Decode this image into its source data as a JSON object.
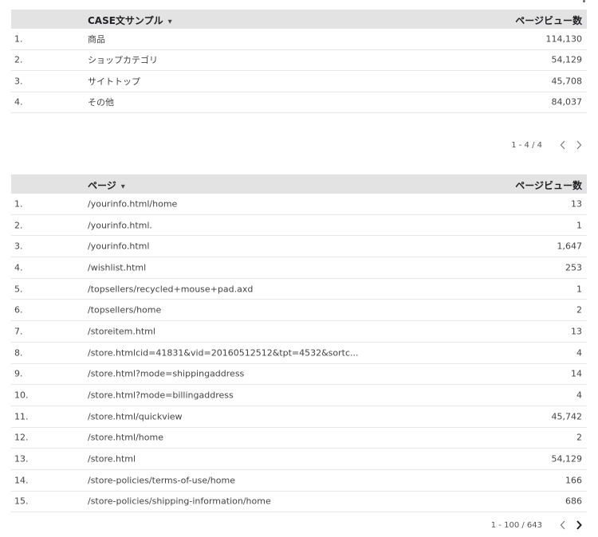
{
  "table1": {
    "header": {
      "dimension": "CASE文サンプル",
      "metric": "ページビュー数"
    },
    "rows": [
      {
        "index": "1.",
        "label": "商品",
        "value": "114,130"
      },
      {
        "index": "2.",
        "label": "ショップカテゴリ",
        "value": "54,129"
      },
      {
        "index": "3.",
        "label": "サイトトップ",
        "value": "45,708"
      },
      {
        "index": "4.",
        "label": "その他",
        "value": "84,037"
      }
    ],
    "pager": {
      "range": "1 - 4 / 4"
    }
  },
  "table2": {
    "header": {
      "dimension": "ページ",
      "metric": "ページビュー数"
    },
    "rows": [
      {
        "index": "1.",
        "label": "/yourinfo.html/home",
        "value": "13"
      },
      {
        "index": "2.",
        "label": "/yourinfo.html.",
        "value": "1"
      },
      {
        "index": "3.",
        "label": "/yourinfo.html",
        "value": "1,647"
      },
      {
        "index": "4.",
        "label": "/wishlist.html",
        "value": "253"
      },
      {
        "index": "5.",
        "label": "/topsellers/recycled+mouse+pad.axd",
        "value": "1"
      },
      {
        "index": "6.",
        "label": "/topsellers/home",
        "value": "2"
      },
      {
        "index": "7.",
        "label": "/storeitem.html",
        "value": "13"
      },
      {
        "index": "8.",
        "label": "/store.htmlcid=41831&vid=20160512512&tpt=4532&sortc...",
        "value": "4"
      },
      {
        "index": "9.",
        "label": "/store.html?mode=shippingaddress",
        "value": "14"
      },
      {
        "index": "10.",
        "label": "/store.html?mode=billingaddress",
        "value": "4"
      },
      {
        "index": "11.",
        "label": "/store.html/quickview",
        "value": "45,742"
      },
      {
        "index": "12.",
        "label": "/store.html/home",
        "value": "2"
      },
      {
        "index": "13.",
        "label": "/store.html",
        "value": "54,129"
      },
      {
        "index": "14.",
        "label": "/store-policies/terms-of-use/home",
        "value": "166"
      },
      {
        "index": "15.",
        "label": "/store-policies/shipping-information/home",
        "value": "686"
      }
    ],
    "pager": {
      "range": "1 - 100 / 643"
    }
  },
  "sort_caret_glyph": "▾",
  "icons": {
    "prev": "chevron-left-icon",
    "next": "chevron-right-icon",
    "sort": "caret-down-icon"
  }
}
